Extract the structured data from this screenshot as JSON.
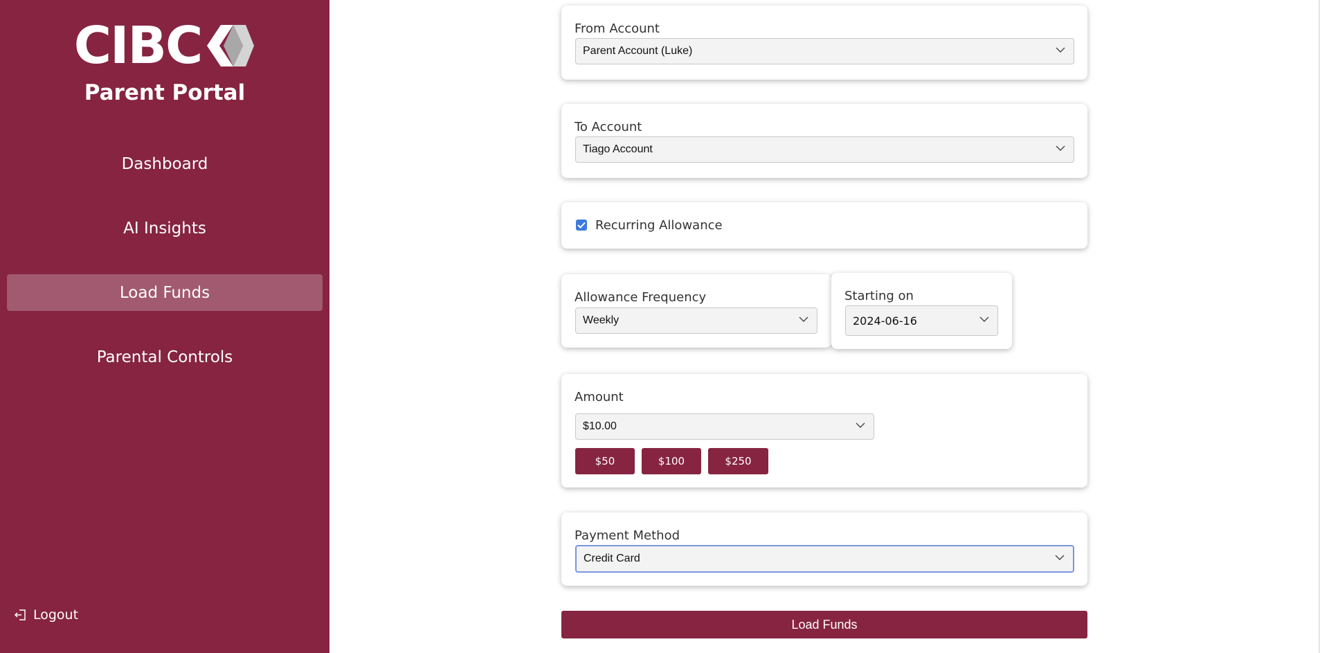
{
  "sidebar": {
    "logo_text": "CIBC",
    "portal_title": "Parent Portal",
    "nav": [
      {
        "label": "Dashboard"
      },
      {
        "label": "AI Insights"
      },
      {
        "label": "Load Funds"
      },
      {
        "label": "Parental Controls"
      }
    ],
    "logout_label": "Logout"
  },
  "form": {
    "from_account": {
      "label": "From Account",
      "value": "Parent Account (Luke)"
    },
    "to_account": {
      "label": "To Account",
      "value": "Tiago Account"
    },
    "recurring": {
      "label": "Recurring Allowance",
      "checked": true
    },
    "frequency": {
      "label": "Allowance Frequency",
      "value": "Weekly"
    },
    "starting_on": {
      "label": "Starting on",
      "value": "2024-06-16"
    },
    "amount": {
      "label": "Amount",
      "value": "$10.00",
      "quick_amounts": [
        "$50",
        "$100",
        "$250"
      ]
    },
    "payment_method": {
      "label": "Payment Method",
      "value": "Credit Card"
    },
    "submit_label": "Load Funds"
  },
  "colors": {
    "brand": "#862442",
    "active_nav": "#a15a70",
    "checkbox": "#3b7ae0",
    "focus_ring": "#7a95e0"
  }
}
